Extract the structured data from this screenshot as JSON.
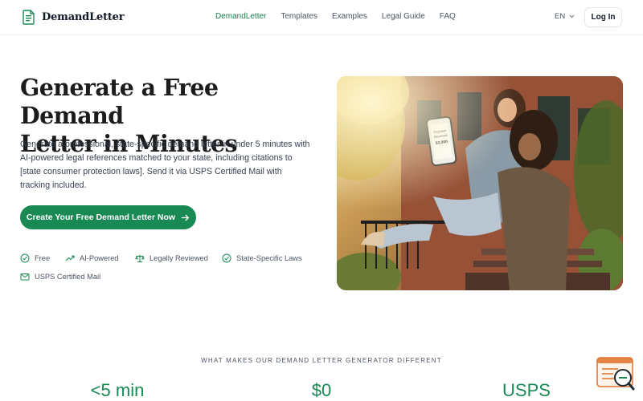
{
  "brand": {
    "name": "DemandLetter",
    "accent": "#1a8a55"
  },
  "nav": {
    "items": [
      {
        "label": "DemandLetter",
        "active": true
      },
      {
        "label": "Templates",
        "active": false
      },
      {
        "label": "Examples",
        "active": false
      },
      {
        "label": "Legal Guide",
        "active": false
      },
      {
        "label": "FAQ",
        "active": false
      }
    ],
    "language": "EN",
    "login_label": "Log In"
  },
  "hero": {
    "title_line1": "Generate a Free Demand",
    "title_line2": "Letter in Minutes",
    "description": "Generate a professional, state-specific demand letter in under 5 minutes with AI-powered legal references matched to your state, including citations to [state consumer protection laws]. Send it via USPS Certified Mail with tracking included.",
    "cta_label": "Create Your Free Demand Letter Now",
    "features": [
      {
        "label": "Free",
        "icon": "check-circle-icon"
      },
      {
        "label": "AI-Powered",
        "icon": "trending-up-icon"
      },
      {
        "label": "Legally Reviewed",
        "icon": "scale-icon"
      },
      {
        "label": "State-Specific Laws",
        "icon": "check-circle-icon"
      },
      {
        "label": "USPS Certified Mail",
        "icon": "mail-icon"
      }
    ],
    "image": {
      "phone_text": "Payment Received $3,000"
    }
  },
  "section": {
    "kicker": "WHAT MAKES OUR DEMAND LETTER GENERATOR DIFFERENT",
    "stats": [
      "<5 min",
      "$0",
      "USPS"
    ]
  }
}
